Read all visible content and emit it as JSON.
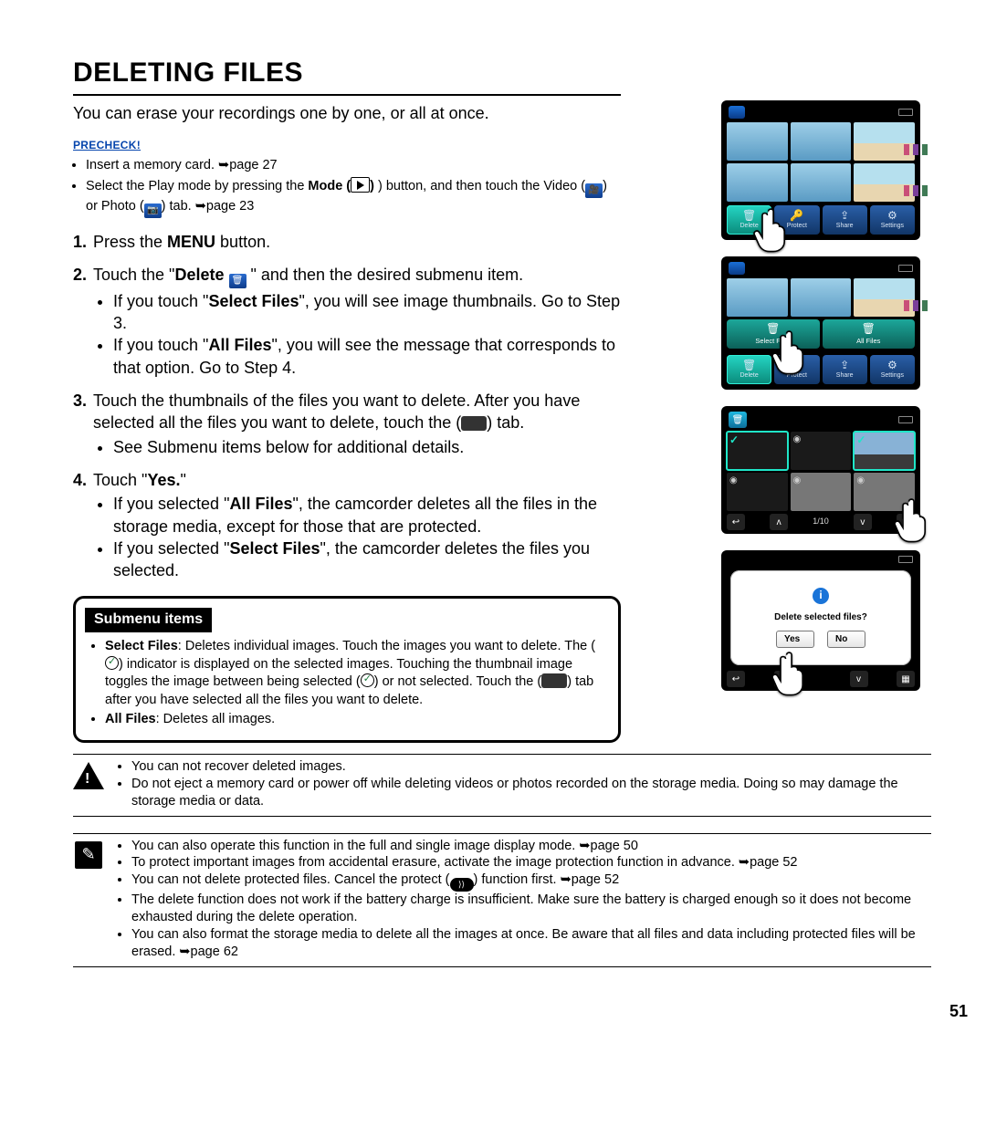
{
  "title": "DELETING FILES",
  "intro": "You can erase your recordings one by one, or all at once.",
  "precheck": {
    "label": "PRECHECK!",
    "items": [
      "Insert a memory card. ➥page 27",
      "Select the Play mode by pressing the Mode (▶) button, and then touch the Video (🎥) or Photo (📷) tab. ➥page 23"
    ],
    "item0": "Insert a memory card. ➥page 27",
    "item1_a": "Select the Play mode by pressing the ",
    "item1_b": "Mode (",
    "item1_c": ") button, and then touch the Video (",
    "item1_d": ") or Photo (",
    "item1_e": ") tab. ➥page 23"
  },
  "steps": {
    "s1_num": "1.",
    "s1_a": "Press the ",
    "s1_menu": "MENU",
    "s1_b": " button.",
    "s2_num": "2.",
    "s2_a": "Touch the \"",
    "s2_delete": "Delete",
    "s2_b": "\" and then the desired submenu item.",
    "s2_bul1_a": "If you touch \"",
    "s2_bul1_b": "Select Files",
    "s2_bul1_c": "\", you will see image thumbnails. Go to Step 3.",
    "s2_bul2_a": "If you touch \"",
    "s2_bul2_b": "All Files",
    "s2_bul2_c": "\", you will see the message that corresponds to that option. Go to Step 4.",
    "s3_num": "3.",
    "s3_a": "Touch the thumbnails of the files you want to delete. After you have selected all the files you want to delete, touch the (",
    "s3_b": ") tab.",
    "s3_bul1": "See Submenu items below for additional details.",
    "s4_num": "4.",
    "s4_a": "Touch \"",
    "s4_yes": "Yes.",
    "s4_b": "\"",
    "s4_bul1_a": "If you selected \"",
    "s4_bul1_b": "All Files",
    "s4_bul1_c": "\", the camcorder deletes all the files in the storage media, except for those that are protected.",
    "s4_bul2_a": "If you selected \"",
    "s4_bul2_b": "Select Files",
    "s4_bul2_c": "\", the camcorder deletes the files you selected."
  },
  "submenu": {
    "title": "Submenu items",
    "item1_lead": "Select Files",
    "item1_a": ": Deletes individual images. Touch the images you want to delete. The (",
    "item1_b": ") indicator is displayed on the selected images. Touching the thumbnail image toggles the image between being selected (",
    "item1_c": ") or not selected. Touch the (",
    "item1_d": ") tab after you have selected all the files you want to delete.",
    "item2_lead": "All Files",
    "item2_a": ": Deletes all images."
  },
  "warning": {
    "w1": "You can not recover deleted images.",
    "w2": "Do not eject a memory card or power off while deleting videos or photos recorded on the storage media. Doing so may damage the storage media or data."
  },
  "notes": {
    "n1": "You can also operate this function in the full and single image display mode. ➥page 50",
    "n2": "To protect important images from accidental erasure, activate the image protection function in advance. ➥page 52",
    "n3_a": "You can not delete protected files. Cancel the protect (",
    "n3_b": ") function first. ➥page 52",
    "n4": "The delete function does not work if the battery charge is insufficient. Make sure the battery is charged enough so it does not become exhausted during the delete operation.",
    "n5": "You can also format the storage media to delete all the images at once. Be aware that all files and data including protected files will be erased. ➥page 62"
  },
  "device": {
    "btn_delete": "Delete",
    "btn_protect": "Protect",
    "btn_share": "Share",
    "btn_settings": "Settings",
    "select_files": "Select Files",
    "all_files": "All Files",
    "pager": "1/10",
    "dialog_q": "Delete selected files?",
    "yes": "Yes",
    "no": "No"
  },
  "page_number": "51"
}
